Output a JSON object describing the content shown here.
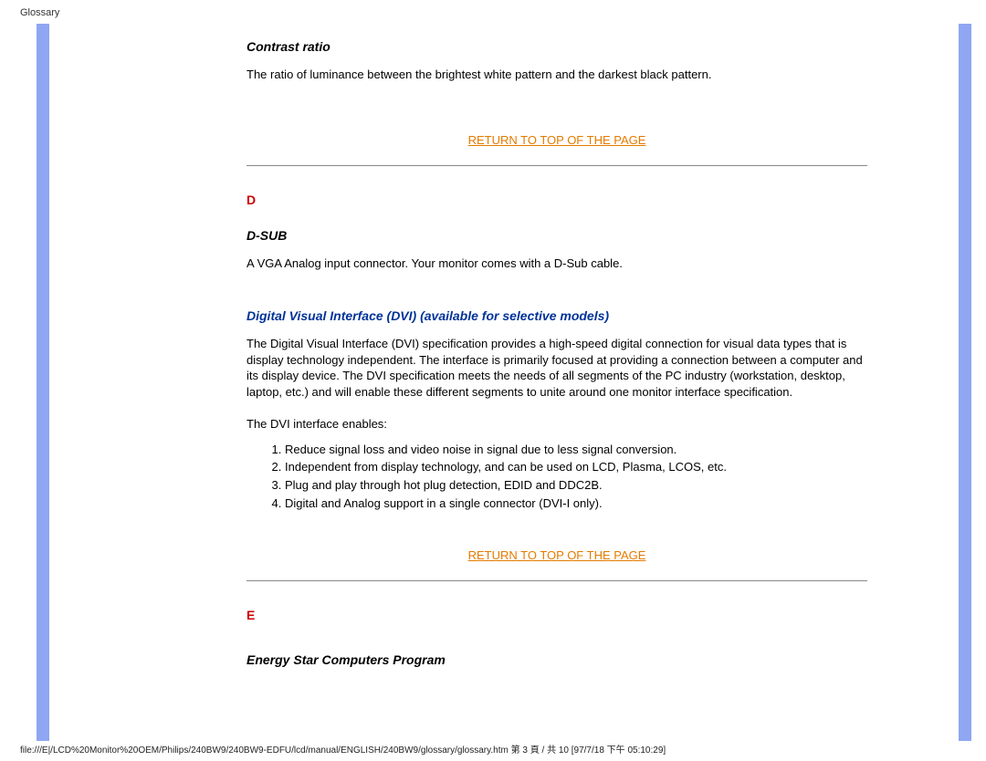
{
  "header": "Glossary",
  "contrast": {
    "title": "Contrast ratio",
    "body": "The ratio of luminance between the brightest white pattern and the darkest black pattern."
  },
  "return_label": "RETURN TO TOP OF THE PAGE",
  "letter_d": "D",
  "dsub": {
    "title": "D-SUB",
    "body": "A VGA Analog input connector. Your monitor comes with a D-Sub cable."
  },
  "dvi": {
    "title": "Digital Visual Interface (DVI) (available for selective models)",
    "body": "The Digital Visual Interface (DVI) specification provides a high-speed digital connection for visual data types that is display technology independent. The interface is primarily focused at providing a connection between a computer and its display device. The DVI specification meets the needs of all segments of the PC industry (workstation, desktop, laptop, etc.) and will enable these different segments to unite around one monitor interface specification.",
    "enables_intro": "The DVI interface enables:",
    "items": {
      "i1": "Reduce signal loss and video noise in signal due to less signal conversion.",
      "i2": "Independent from display technology, and can be used on LCD, Plasma, LCOS, etc.",
      "i3": "Plug and play through hot plug detection, EDID and DDC2B.",
      "i4": "Digital and Analog support in a single connector (DVI-I only)."
    }
  },
  "letter_e": "E",
  "energy": {
    "title": "Energy Star Computers Program"
  },
  "footer": "file:///E|/LCD%20Monitor%20OEM/Philips/240BW9/240BW9-EDFU/lcd/manual/ENGLISH/240BW9/glossary/glossary.htm 第 3 頁 / 共 10  [97/7/18 下午 05:10:29]"
}
